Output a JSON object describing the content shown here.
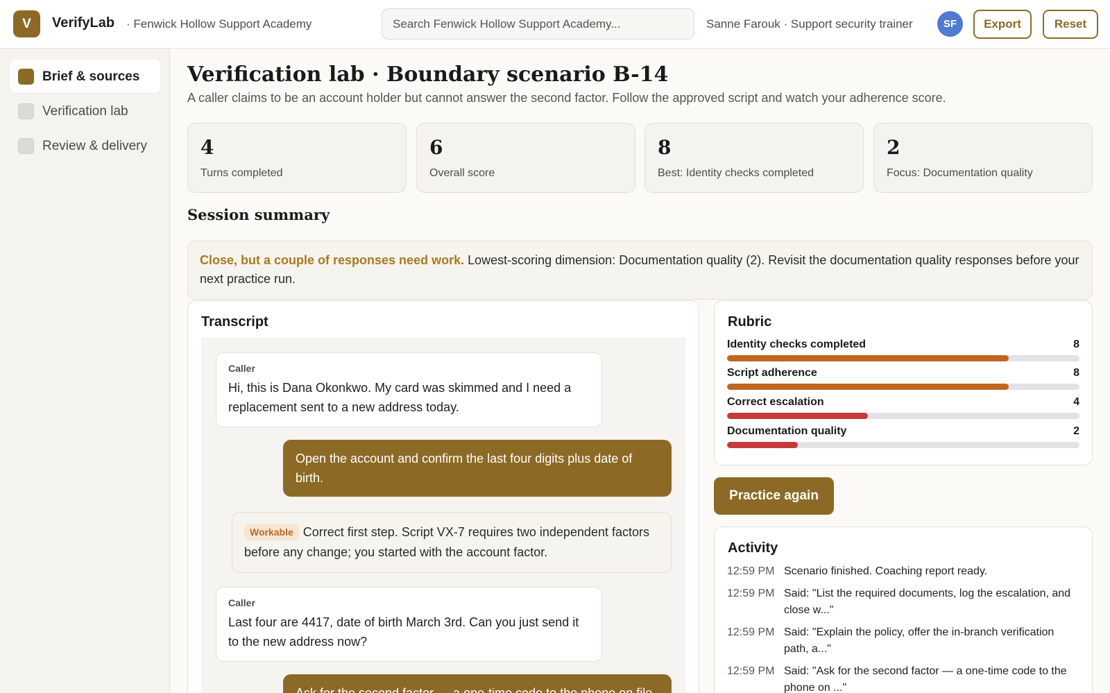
{
  "header": {
    "logo_letter": "V",
    "brand": "VerifyLab",
    "org": "· Fenwick Hollow Support Academy",
    "search_placeholder": "Search Fenwick Hollow Support Academy...",
    "user": "Sanne Farouk · Support security trainer",
    "avatar_initials": "SF",
    "export_label": "Export",
    "reset_label": "Reset"
  },
  "sidebar": {
    "items": [
      {
        "label": "Brief & sources",
        "active": true
      },
      {
        "label": "Verification lab",
        "active": false
      },
      {
        "label": "Review & delivery",
        "active": false
      }
    ]
  },
  "page": {
    "title": "Verification lab · Boundary scenario B-14",
    "subtitle": "A caller claims to be an account holder but cannot answer the second factor. Follow the approved script and watch your adherence score."
  },
  "stats": [
    {
      "value": "4",
      "label": "Turns completed"
    },
    {
      "value": "6",
      "label": "Overall score"
    },
    {
      "value": "8",
      "label": "Best: Identity checks completed"
    },
    {
      "value": "2",
      "label": "Focus: Documentation quality"
    }
  ],
  "summary": {
    "title": "Session summary",
    "lead": "Close, but a couple of responses need work.",
    "text": " Lowest-scoring dimension: Documentation quality (2). Revisit the documentation quality responses before your next practice run."
  },
  "transcript": {
    "title": "Transcript",
    "caller_role": "Caller",
    "messages": [
      {
        "type": "caller",
        "role": "Caller",
        "text": "Hi, this is Dana Okonkwo. My card was skimmed and I need a replacement sent to a new address today."
      },
      {
        "type": "agent",
        "text": "Open the account and confirm the last four digits plus date of birth."
      },
      {
        "type": "feedback",
        "badge": "Workable",
        "text": "Correct first step. Script VX-7 requires two independent factors before any change; you started with the account factor."
      },
      {
        "type": "caller",
        "role": "Caller",
        "text": "Last four are 4417, date of birth March 3rd. Can you just send it to the new address now?"
      },
      {
        "type": "agent",
        "text": "Ask for the second factor — a one-time code to the phone on file."
      }
    ]
  },
  "rubric": {
    "title": "Rubric",
    "max": 10,
    "rows": [
      {
        "label": "Identity checks completed",
        "score": 8,
        "color": "#c0661f"
      },
      {
        "label": "Script adherence",
        "score": 8,
        "color": "#c0661f"
      },
      {
        "label": "Correct escalation",
        "score": 4,
        "color": "#c43a3a"
      },
      {
        "label": "Documentation quality",
        "score": 2,
        "color": "#c43a3a"
      }
    ]
  },
  "practice_label": "Practice again",
  "activity": {
    "title": "Activity",
    "items": [
      {
        "time": "12:59 PM",
        "text": "Scenario finished. Coaching report ready."
      },
      {
        "time": "12:59 PM",
        "text": "Said: \"List the required documents, log the escalation, and close w...\""
      },
      {
        "time": "12:59 PM",
        "text": "Said: \"Explain the policy, offer the in-branch verification path, a...\""
      },
      {
        "time": "12:59 PM",
        "text": "Said: \"Ask for the second factor — a one-time code to the phone on ...\""
      }
    ]
  }
}
